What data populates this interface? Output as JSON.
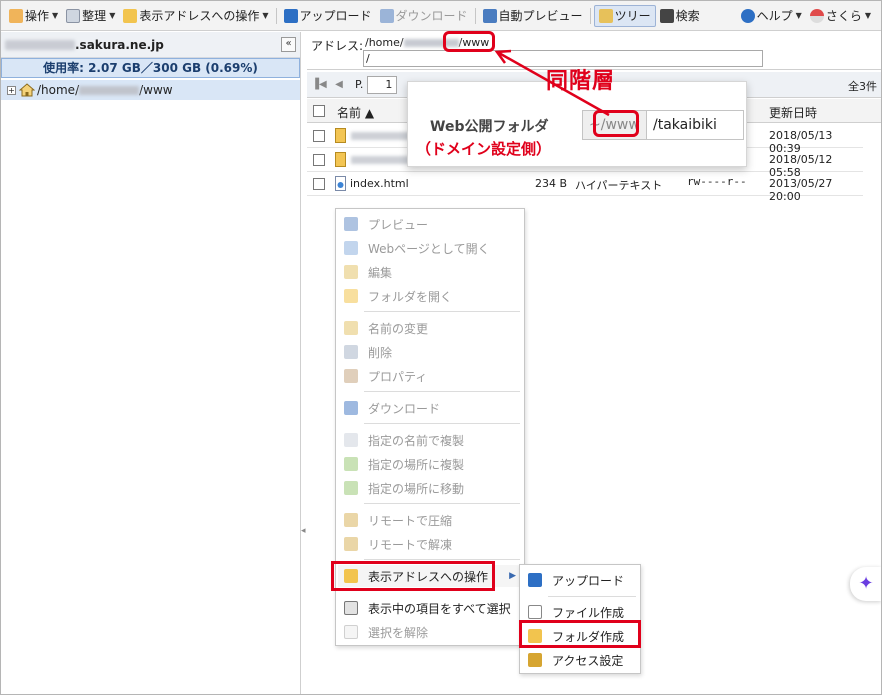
{
  "toolbar": {
    "operation": "操作",
    "organize": "整理",
    "address_ops": "表示アドレスへの操作",
    "upload": "アップロード",
    "download": "ダウンロード",
    "auto_preview": "自動プレビュー",
    "tree": "ツリー",
    "search": "検索",
    "help": "ヘルプ",
    "user": "さくら"
  },
  "left": {
    "host_suffix": ".sakura.ne.jp",
    "collapse": "«",
    "usage": "使用率: 2.07 GB／300 GB (0.69%)",
    "tree_prefix": "/home/",
    "tree_suffix": "/www"
  },
  "address": {
    "label": "アドレス:",
    "value_prefix": "/home/",
    "value_suffix": "/www",
    "sub_value": "/"
  },
  "nav": {
    "page_label": "P.",
    "page_value": "1",
    "count": "全3件"
  },
  "grid": {
    "col_name": "名前 ▲",
    "col_date": "更新日時",
    "rows": [
      {
        "name": "",
        "size": "",
        "type": "",
        "perm": "",
        "date": "2018/05/13 00:39"
      },
      {
        "name": "",
        "size": "",
        "type": "",
        "perm": "",
        "date": "2018/05/12 05:58"
      },
      {
        "name": "index.html",
        "size": "234 B",
        "type": "ハイパーテキスト",
        "perm": "rw----r--",
        "date": "2013/05/27 20:00"
      }
    ]
  },
  "callout": {
    "title": "同階層",
    "label": "Web公開フォルダ",
    "prefix": "~/www",
    "value": "/takaibiki",
    "note": "（ドメイン設定側）"
  },
  "context_menu": {
    "items": [
      "プレビュー",
      "Webページとして開く",
      "編集",
      "フォルダを開く",
      "名前の変更",
      "削除",
      "プロパティ",
      "ダウンロード",
      "指定の名前で複製",
      "指定の場所に複製",
      "指定の場所に移動",
      "リモートで圧縮",
      "リモートで解凍",
      "表示アドレスへの操作",
      "表示中の項目をすべて選択",
      "選択を解除"
    ]
  },
  "sub_menu": {
    "items": [
      "アップロード",
      "ファイル作成",
      "フォルダ作成",
      "アクセス設定"
    ]
  },
  "colors": {
    "accent_red": "#e0001b",
    "selection_blue": "#d9e6f6"
  }
}
